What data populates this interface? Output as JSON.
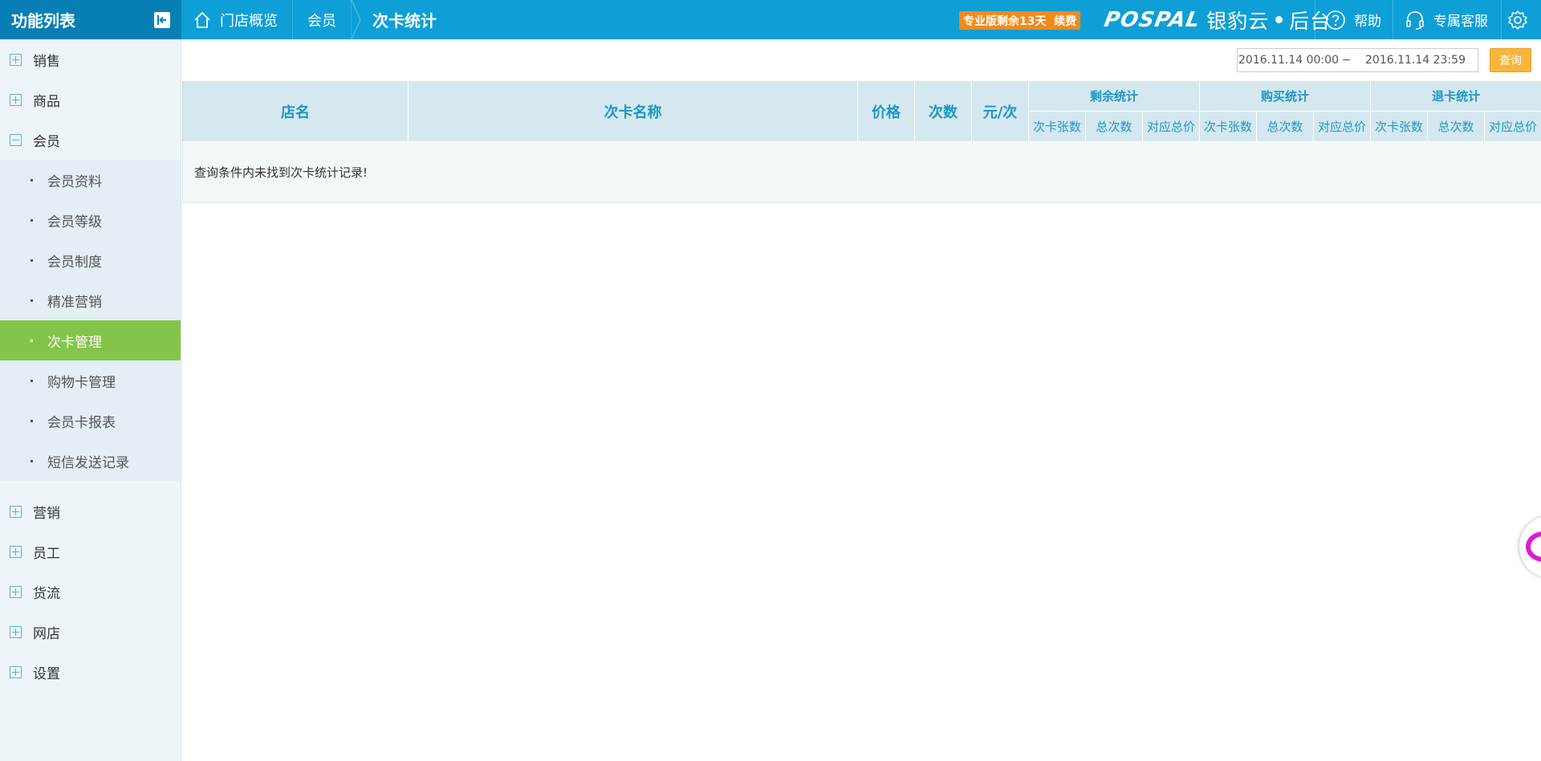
{
  "header": {
    "menu_title": "功能列表",
    "breadcrumbs": [
      "门店概览",
      "会员",
      "次卡统计"
    ],
    "trial_badge": "专业版剩余13天  续费",
    "brand_latin": "POSPAL",
    "brand_cn": "银豹云",
    "brand_suffix": "后台",
    "help": "帮助",
    "service": "专属客服"
  },
  "sidebar": {
    "groups_top": [
      {
        "label": "销售",
        "expanded": false
      },
      {
        "label": "商品",
        "expanded": false
      },
      {
        "label": "会员",
        "expanded": true
      }
    ],
    "member_items": [
      {
        "label": "会员资料",
        "active": false
      },
      {
        "label": "会员等级",
        "active": false
      },
      {
        "label": "会员制度",
        "active": false
      },
      {
        "label": "精准营销",
        "active": false
      },
      {
        "label": "次卡管理",
        "active": true
      },
      {
        "label": "购物卡管理",
        "active": false
      },
      {
        "label": "会员卡报表",
        "active": false
      },
      {
        "label": "短信发送记录",
        "active": false
      }
    ],
    "groups_bottom": [
      {
        "label": "营销",
        "expanded": false
      },
      {
        "label": "员工",
        "expanded": false
      },
      {
        "label": "货流",
        "expanded": false
      },
      {
        "label": "网店",
        "expanded": false
      },
      {
        "label": "设置",
        "expanded": false
      }
    ]
  },
  "filter": {
    "start": "2016.11.14 00:00",
    "separator": "−",
    "end": "2016.11.14 23:59",
    "query_label": "查询"
  },
  "table": {
    "main_headers": [
      "店名",
      "次卡名称",
      "价格",
      "次数",
      "元/次"
    ],
    "group_headers": [
      "剩余统计",
      "购买统计",
      "退卡统计"
    ],
    "sub_headers": [
      "次卡张数",
      "总次数",
      "对应总价"
    ],
    "empty_message": "查询条件内未找到次卡统计记录!"
  },
  "colors": {
    "topbar": "#0e9fd6",
    "active_item": "#84c44b",
    "header_text": "#1d97c6",
    "badge": "#f28a1b",
    "query": "#f7b53b"
  }
}
